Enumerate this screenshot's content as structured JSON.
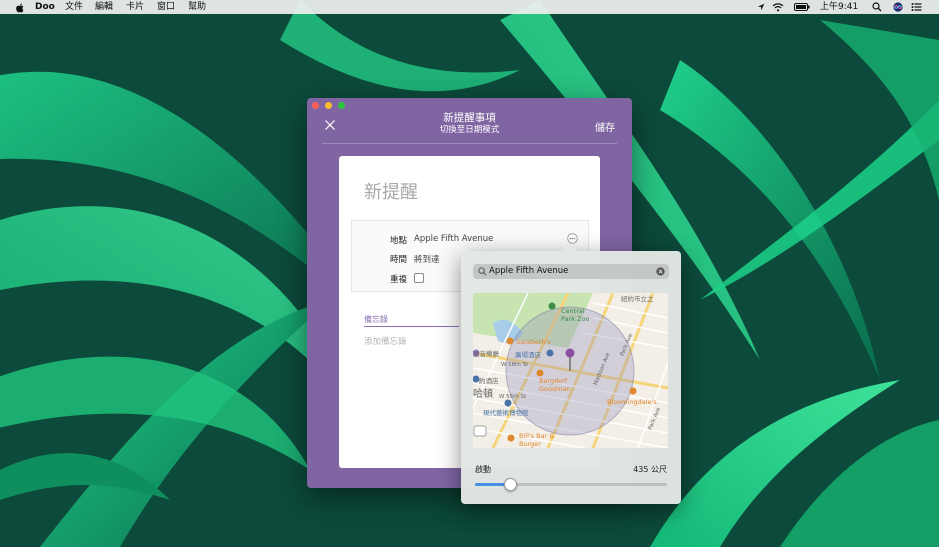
{
  "menubar": {
    "app_name": "Doo",
    "items": [
      "文件",
      "編輯",
      "卡片",
      "窗口",
      "幫助"
    ],
    "clock": "上午9:41"
  },
  "window": {
    "title": "新提醒事項",
    "subtitle": "切換至日期模式",
    "save_label": "儲存",
    "card": {
      "placeholder_title": "新提醒",
      "location_label": "地點",
      "location_value": "Apple Fifth Avenue",
      "time_label": "時間",
      "time_value": "將到達",
      "repeat_label": "重複",
      "repeat_checked": false,
      "notes_label": "備忘錄",
      "notes_placeholder": "添加備忘錄"
    }
  },
  "popover": {
    "search_value": "Apple Fifth Avenue",
    "map_labels": {
      "central_park_zoo": "Central\nPark Zoo",
      "museum": "紐約市立之",
      "sarabeths": "Sarabeth's",
      "plaza_hotel": "廣場酒店",
      "music_hall": "嘉音樂廳",
      "hotel_short": "約酒店",
      "bergdorf": "Bergdorf\nGoodman",
      "bloomingdales": "Bloomingdale's",
      "moma": "現代藝術博物館",
      "bills": "Bill's Bar &\nBurger",
      "manhattan": "哈頓",
      "w_58th": "W 58th St",
      "w_55th": "W 55th St",
      "madison": "Madison Ave",
      "park_ave": "Park Ave",
      "park_ave_2": "Park Ave"
    },
    "radius_label": "啟動",
    "radius_value": "435 公尺",
    "radius_fraction": 0.18
  },
  "colors": {
    "window_purple": "#7f66a3",
    "accent_blue": "#4a90e2",
    "pin_purple": "#8a4fa0"
  }
}
